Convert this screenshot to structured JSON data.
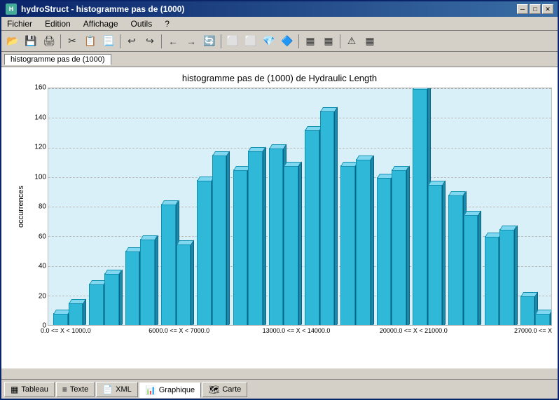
{
  "window": {
    "title": "hydroStruct - histogramme pas de (1000)",
    "icon": "H"
  },
  "titlebar": {
    "minimize": "─",
    "maximize": "□",
    "close": "✕"
  },
  "menu": {
    "items": [
      "Fichier",
      "Edition",
      "Affichage",
      "Outils",
      "?"
    ]
  },
  "toolbar": {
    "buttons": [
      "📂",
      "💾",
      "🖨",
      "✂",
      "📋",
      "📃",
      "↩",
      "↪",
      "←",
      "→",
      "🔄",
      "⬜",
      "⬜",
      "💎",
      "⬜",
      "▦",
      "▦",
      "⚠",
      "▦"
    ]
  },
  "doc_tab": {
    "label": "histogramme pas de (1000)"
  },
  "chart": {
    "title": "histogramme pas de (1000) de Hydraulic Length",
    "y_axis_label": "occurrences",
    "y_ticks": [
      "160",
      "140",
      "120",
      "100",
      "80",
      "60",
      "40",
      "20",
      "0"
    ],
    "y_max": 160,
    "bars": [
      {
        "label": "0.0 <= X < 1000.0",
        "values": [
          8,
          15
        ]
      },
      {
        "label": "",
        "values": [
          28,
          35
        ]
      },
      {
        "label": "",
        "values": [
          50,
          58
        ]
      },
      {
        "label": "6000.0 <= X < 7000.0",
        "values": [
          82,
          55
        ]
      },
      {
        "label": "",
        "values": [
          98,
          115
        ]
      },
      {
        "label": "",
        "values": [
          105,
          118
        ]
      },
      {
        "label": "",
        "values": [
          120,
          108
        ]
      },
      {
        "label": "13000.0 <= X < 14000.0",
        "values": [
          132,
          145
        ]
      },
      {
        "label": "",
        "values": [
          108,
          112
        ]
      },
      {
        "label": "",
        "values": [
          100,
          105
        ]
      },
      {
        "label": "20000.0 <= X < 21000.0",
        "values": [
          160,
          95
        ]
      },
      {
        "label": "",
        "values": [
          88,
          75
        ]
      },
      {
        "label": "",
        "values": [
          60,
          65
        ]
      },
      {
        "label": "27000.0 <= X",
        "values": [
          20,
          8
        ]
      }
    ],
    "x_labels": [
      "0.0 <= X < 1000.0",
      "6000.0 <= X < 7000.0",
      "13000.0 <= X < 14000.0",
      "20000.0 <= X < 21000.0",
      "27000.0 <= X"
    ]
  },
  "bottom_tabs": [
    {
      "label": "Tableau",
      "icon": "▦",
      "active": true
    },
    {
      "label": "Texte",
      "icon": "≡",
      "active": false
    },
    {
      "label": "XML",
      "icon": "📄",
      "active": false
    },
    {
      "label": "Graphique",
      "icon": "📊",
      "active": false
    },
    {
      "label": "Carte",
      "icon": "🗺",
      "active": false
    }
  ]
}
